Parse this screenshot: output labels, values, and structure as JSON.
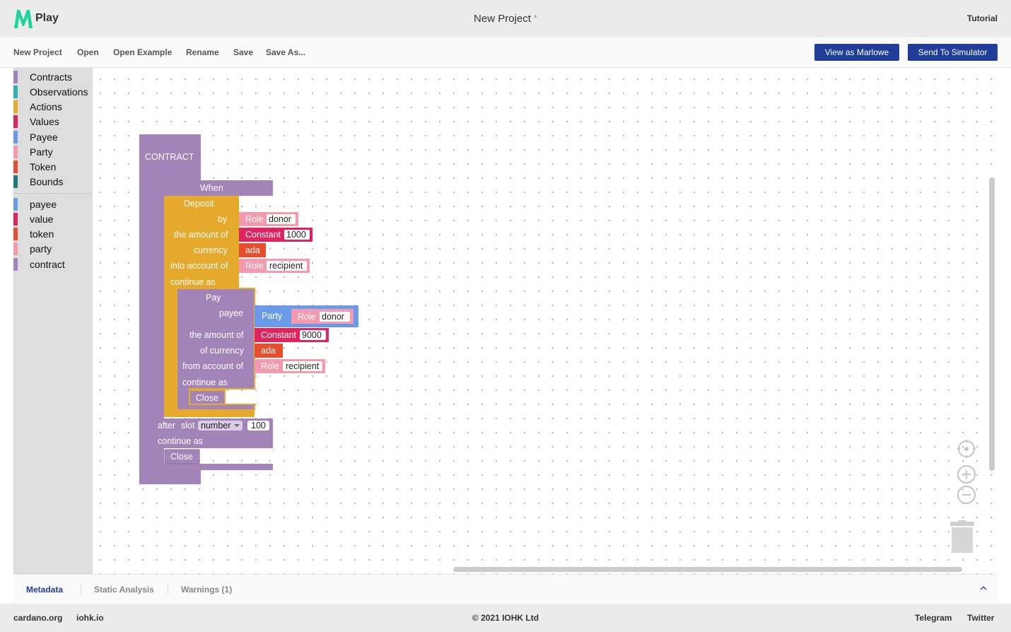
{
  "header": {
    "app_name": "Play",
    "project_title": "New Project",
    "unsaved_marker": "*",
    "tutorial_label": "Tutorial"
  },
  "menu": {
    "items": [
      "New Project",
      "Open",
      "Open Example",
      "Rename",
      "Save",
      "Save As..."
    ],
    "view_as_marlowe_label": "View as Marlowe",
    "send_to_simulator_label": "Send To Simulator"
  },
  "toolbox": {
    "categories": [
      {
        "label": "Contracts",
        "color": "#a384b8"
      },
      {
        "label": "Observations",
        "color": "#2bb3b3"
      },
      {
        "label": "Actions",
        "color": "#e5a92c"
      },
      {
        "label": "Values",
        "color": "#e0245e"
      },
      {
        "label": "Payee",
        "color": "#6a9ae8"
      },
      {
        "label": "Party",
        "color": "#f39aaf"
      },
      {
        "label": "Token",
        "color": "#e84e2b"
      },
      {
        "label": "Bounds",
        "color": "#1f7a7a"
      }
    ],
    "variables": [
      {
        "label": "payee",
        "color": "#6a9ae8"
      },
      {
        "label": "value",
        "color": "#e0245e"
      },
      {
        "label": "token",
        "color": "#e84e2b"
      },
      {
        "label": "party",
        "color": "#f39aaf"
      },
      {
        "label": "contract",
        "color": "#a384b8"
      }
    ]
  },
  "blocks": {
    "contract": "CONTRACT",
    "when": "When",
    "deposit": "Deposit",
    "by": "by",
    "amount_of": "the amount of",
    "currency": "currency",
    "into_account_of": "into account of",
    "continue_as": "continue as",
    "role": "Role",
    "donor": "donor",
    "recipient": "recipient",
    "constant": "Constant",
    "deposit_amount": "1000",
    "ada": "ada",
    "pay": "Pay",
    "payee": "payee",
    "party": "Party",
    "pay_amount_of": "the amount of",
    "of_currency": "of currency",
    "from_account_of": "from account of",
    "pay_amount": "9000",
    "close": "Close",
    "after": "after",
    "slot": "slot",
    "slot_type": "number",
    "slot_value": "100"
  },
  "bottom_tabs": {
    "metadata": "Metadata",
    "static_analysis": "Static Analysis",
    "warnings": "Warnings (1)"
  },
  "footer": {
    "cardano": "cardano.org",
    "iohk": "iohk.io",
    "copyright": "© 2021 IOHK Ltd",
    "telegram": "Telegram",
    "twitter": "Twitter"
  },
  "colors": {
    "brand_green": "#1fd49c",
    "primary_button": "#1f3d99",
    "contract_purple": "#a384b8",
    "action_yellow": "#e5a92c",
    "value_red": "#e0245e",
    "token_orange": "#e84e2b",
    "party_pink": "#f39aaf",
    "payee_blue": "#6a9ae8"
  }
}
